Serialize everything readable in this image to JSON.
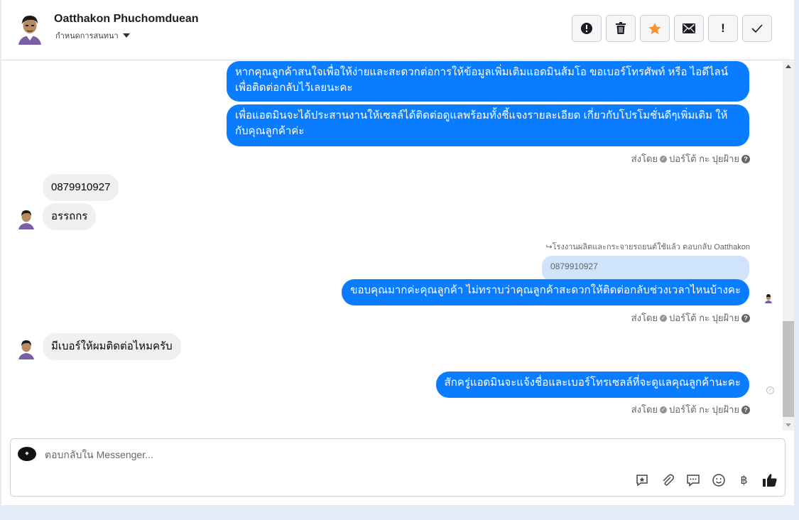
{
  "header": {
    "name": "Oatthakon Phuchomduean",
    "assign_label": "กำหนดการสนทนา"
  },
  "toolbar": {
    "spam_glyph": "!",
    "trash_glyph": "🗑",
    "star_glyph": "★",
    "mail_glyph": "✉",
    "important_glyph": "!",
    "done_glyph": "✓"
  },
  "messages": {
    "out1": "หากคุณลูกค้าสนใจเพื่อให้ง่ายและสะดวกต่อการให้ข้อมูลเพิ่มเติมแอดมินส้มโอ ขอเบอร์โทรศัพท์ หรือ ไอดีไลน์ เพื่อติดต่อกลับไว้เลยนะคะ",
    "out2": "เพื่อแอดมินจะได้ประสานงานให้เซลล์ได้ติดต่อดูแลพร้อมทั้งชี้แจงรายละเอียด เกี่ยวกับโปรโมชั่นดีๆเพิ่มเติม ให้กับคุณลูกค้าค่ะ",
    "sent_by_1": "ส่งโดย",
    "sender_1": "ปอร์โต้ กะ ปุยฝ้าย",
    "in1": "0879910927",
    "in2": "อรรถกร",
    "reply_note": "โรงงานผลิตและกระจายรถยนต์ใช้แล้ว ตอบกลับ Oatthakon",
    "quoted": "0879910927",
    "out3": "ขอบคุณมากค่ะคุณลูกค้า ไม่ทราบว่าคุณลูกค้าสะดวกให้ติดต่อกลับช่วงเวลาไหนบ้างคะ",
    "sent_by_2": "ส่งโดย",
    "sender_2": "ปอร์โต้ กะ ปุยฝ้าย",
    "in3": "มีเบอร์ให้ผมติดต่อไหมครับ",
    "out4": "สักครู่แอดมินจะแจ้งชื่อและเบอร์โทรเซลล์ที่จะดูแลคุณลูกค้านะคะ",
    "sent_by_3": "ส่งโดย",
    "sender_3": "ปอร์โต้ กะ ปุยฝ้าย"
  },
  "composer": {
    "placeholder": "ตอบกลับใน Messenger...",
    "currency_glyph": "฿"
  },
  "colors": {
    "outgoing_bubble": "#0a7cff",
    "incoming_bubble": "#f0f0f0",
    "star": "#f7923a",
    "quoted_bubble": "#cfe3fb"
  }
}
